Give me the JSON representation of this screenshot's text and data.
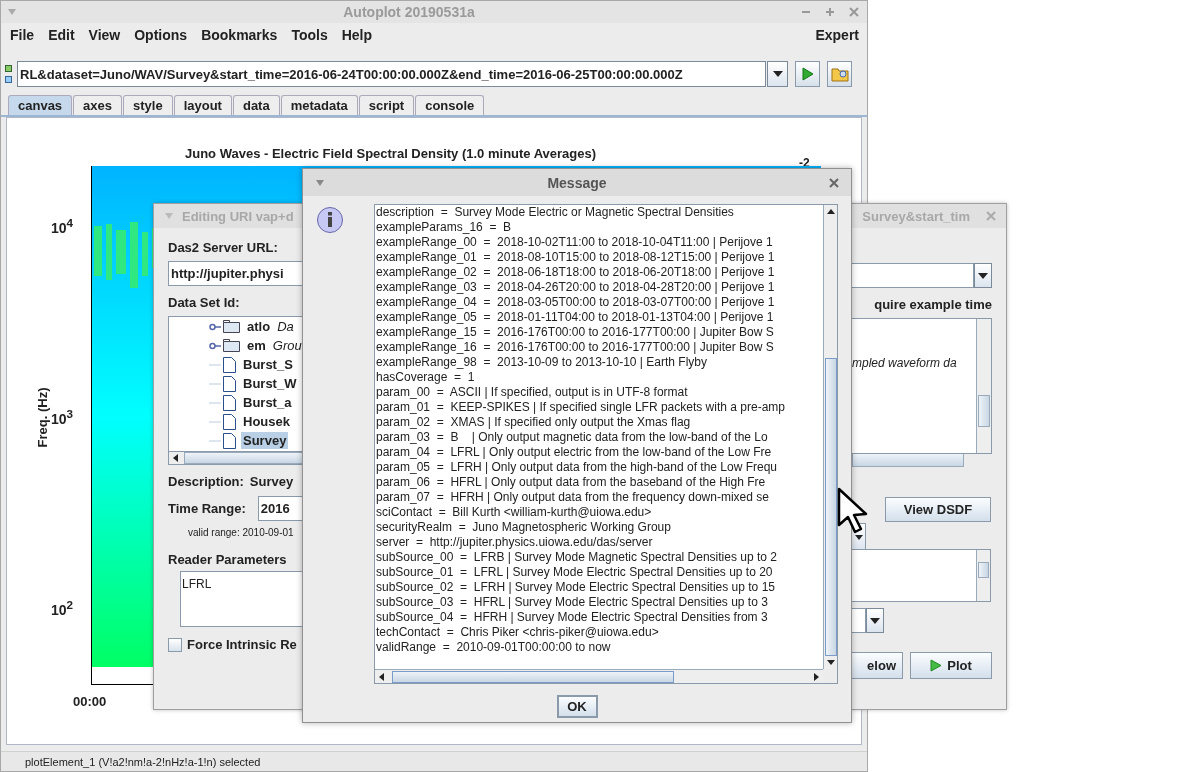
{
  "window": {
    "title": "Autoplot 20190531a"
  },
  "menu": [
    "File",
    "Edit",
    "View",
    "Options",
    "Bookmarks",
    "Tools",
    "Help"
  ],
  "menu_right": "Expert",
  "uri_field": {
    "value": "RL&dataset=Juno/WAV/Survey&start_time=2016-06-24T00:00:00.000Z&end_time=2016-06-25T00:00:00.000Z"
  },
  "tabs": [
    {
      "label": "canvas",
      "selected": true
    },
    {
      "label": "axes",
      "selected": false
    },
    {
      "label": "style",
      "selected": false
    },
    {
      "label": "layout",
      "selected": false
    },
    {
      "label": "data",
      "selected": false
    },
    {
      "label": "metadata",
      "selected": false
    },
    {
      "label": "script",
      "selected": false
    },
    {
      "label": "console",
      "selected": false
    }
  ],
  "plot": {
    "title": "Juno Waves - Electric Field Spectral Density (1.0 minute Averages)",
    "ylabel": "Freq. (Hz)",
    "yticks": [
      "10$^{4}$",
      "10$^{3}$",
      "10$^{2}$"
    ],
    "xticks": [
      "00:00"
    ],
    "colorbar_label": "-2"
  },
  "editor_dialog": {
    "title_left": "Editing URI vap+d",
    "title_right": "Survey&start_tim",
    "server_label": "Das2 Server URL:",
    "server_value": "http://jupiter.physi",
    "dataset_label": "Data Set Id:",
    "tree": [
      {
        "kind": "folder",
        "name": "atlo",
        "note": "Da",
        "selected": false
      },
      {
        "kind": "folder",
        "name": "em",
        "note": "Grou",
        "selected": false
      },
      {
        "kind": "file",
        "name": "Burst_S",
        "selected": false
      },
      {
        "kind": "file",
        "name": "Burst_W",
        "selected": false
      },
      {
        "kind": "file",
        "name": "Burst_a",
        "selected": false
      },
      {
        "kind": "file",
        "name": "Housek",
        "selected": false
      },
      {
        "kind": "file",
        "name": "Survey",
        "selected": true
      }
    ],
    "description_label": "Description:",
    "description_value": "Survey",
    "time_range_label": "Time Range:",
    "time_range_value": "2016",
    "valid_range": "valid range: 2010-09-01",
    "reader_label": "Reader Parameters",
    "reader_value": "LFRL",
    "force_checkbox": {
      "label": "Force Intrinsic Re",
      "checked": false
    },
    "example_label": "quire example time",
    "example_text": "mpled waveform da",
    "view_button": "View DSDF",
    "below_button": "elow",
    "plot_button": "Plot"
  },
  "message_dialog": {
    "title": "Message",
    "lines": [
      "description  =  Survey Mode Electric or Magnetic Spectral Densities",
      "exampleParams_16  =  B",
      "exampleRange_00  =  2018-10-02T11:00 to 2018-10-04T11:00 | Perijove 1",
      "exampleRange_01  =  2018-08-10T15:00 to 2018-08-12T15:00 | Perijove 1",
      "exampleRange_02  =  2018-06-18T18:00 to 2018-06-20T18:00 | Perijove 1",
      "exampleRange_03  =  2018-04-26T20:00 to 2018-04-28T20:00 | Perijove 1",
      "exampleRange_04  =  2018-03-05T00:00 to 2018-03-07T00:00 | Perijove 1",
      "exampleRange_05  =  2018-01-11T04:00 to 2018-01-13T04:00 | Perijove 1",
      "exampleRange_15  =  2016-176T00:00 to 2016-177T00:00 | Jupiter Bow S",
      "exampleRange_16  =  2016-176T00:00 to 2016-177T00:00 | Jupiter Bow S",
      "exampleRange_98  =  2013-10-09 to 2013-10-10 | Earth Flyby",
      "hasCoverage  =  1",
      "param_00  =  ASCII | If specified, output is in UTF-8 format",
      "param_01  =  KEEP-SPIKES | If specified single LFR packets with a pre-amp",
      "param_02  =  XMAS | If specified only output the Xmas flag",
      "param_03  =  B    | Only output magnetic data from the low-band of the Lo",
      "param_04  =  LFRL | Only output electric from the low-band of the Low Fre",
      "param_05  =  LFRH | Only output data from the high-band of the Low Frequ",
      "param_06  =  HFRL | Only output data from the baseband of the High Fre",
      "param_07  =  HFRH | Only output data from the frequency down-mixed se",
      "sciContact  =  Bill Kurth <william-kurth@uiowa.edu>",
      "securityRealm  =  Juno Magnetospheric Working Group",
      "server  =  http://jupiter.physics.uiowa.edu/das/server",
      "subSource_00  =  LFRB | Survey Mode Magnetic Spectral Densities up to 2",
      "subSource_01  =  LFRL | Survey Mode Electric Spectral Densities up to 20",
      "subSource_02  =  LFRH | Survey Mode Electric Spectral Densities up to 15",
      "subSource_03  =  HFRL | Survey Mode Electric Spectral Densities up to 3",
      "subSource_04  =  HFRH | Survey Mode Electric Spectral Densities from 3",
      "techContact  =  Chris Piker <chris-piker@uiowa.edu>",
      "validRange  =  2010-09-01T00:00:00 to now"
    ],
    "ok_button": "OK"
  },
  "status_bar": "plotElement_1 (V!a2!nm!a-2!nHz!a-1!n) selected"
}
